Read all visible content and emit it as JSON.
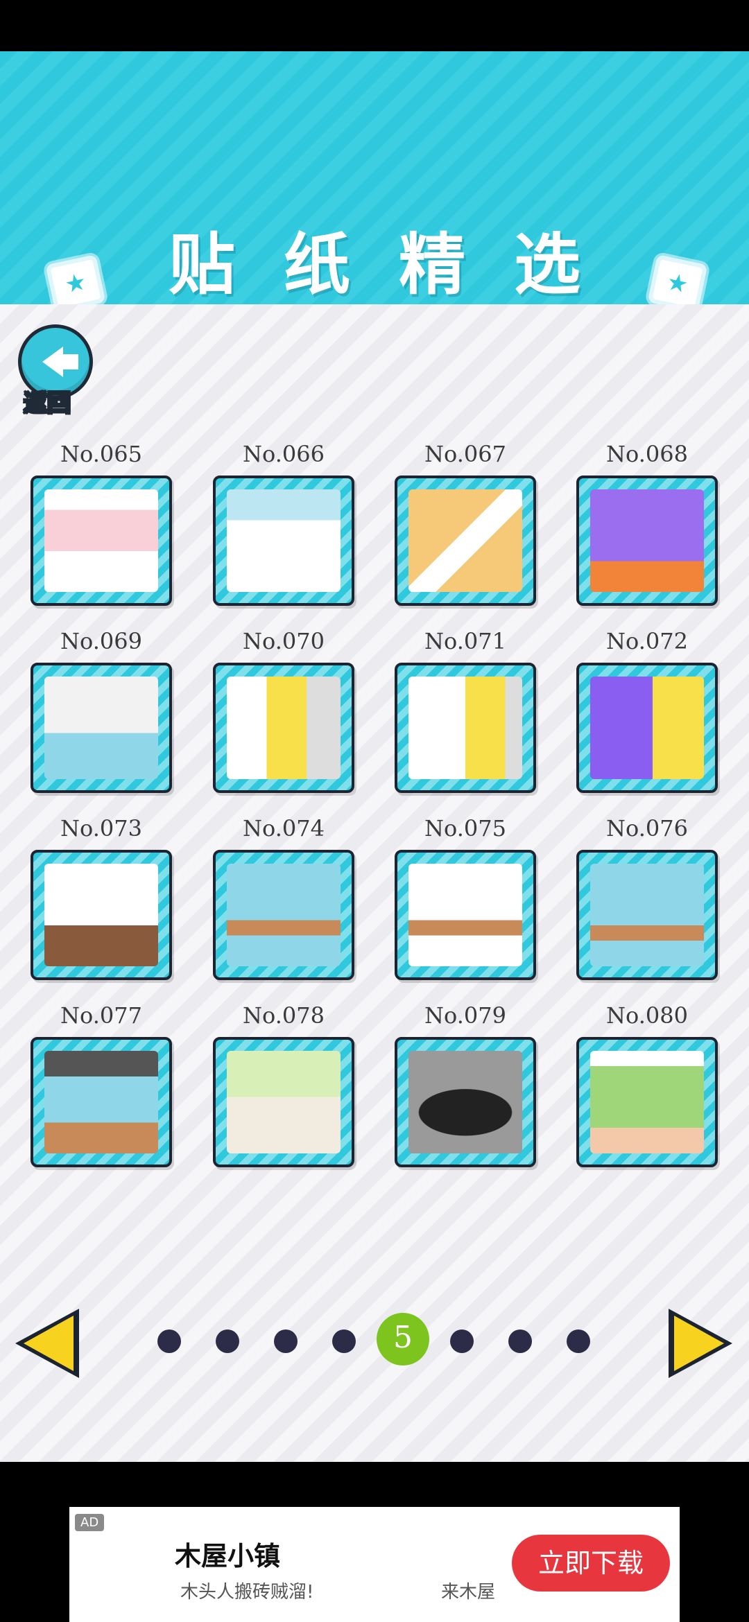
{
  "header": {
    "title": "贴纸精选"
  },
  "back_button": {
    "label": "返回"
  },
  "stickers": [
    {
      "no": "No.065"
    },
    {
      "no": "No.066"
    },
    {
      "no": "No.067"
    },
    {
      "no": "No.068"
    },
    {
      "no": "No.069"
    },
    {
      "no": "No.070"
    },
    {
      "no": "No.071"
    },
    {
      "no": "No.072"
    },
    {
      "no": "No.073"
    },
    {
      "no": "No.074"
    },
    {
      "no": "No.075"
    },
    {
      "no": "No.076"
    },
    {
      "no": "No.077"
    },
    {
      "no": "No.078"
    },
    {
      "no": "No.079"
    },
    {
      "no": "No.080"
    }
  ],
  "pagination": {
    "current_page": "5",
    "total_dots": 8,
    "active_index": 4
  },
  "ad": {
    "tag": "AD",
    "title": "木屋小镇",
    "subtitle": "木头人搬砖贼溜!",
    "subtitle2": "来木屋",
    "cta": "立即下载"
  },
  "colors": {
    "header": "#2fc8dc",
    "active_dot": "#7dc41f",
    "arrow": "#f7d21e",
    "cta": "#e8363e"
  }
}
